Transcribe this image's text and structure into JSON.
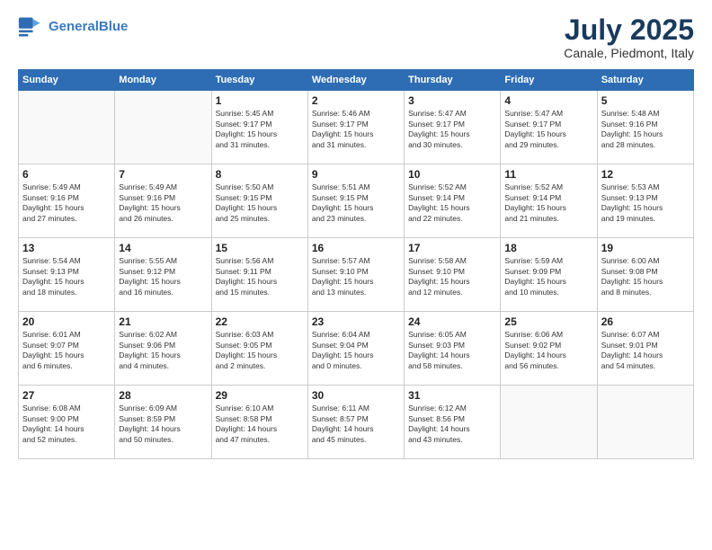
{
  "header": {
    "logo_line1": "General",
    "logo_line2": "Blue",
    "title": "July 2025",
    "subtitle": "Canale, Piedmont, Italy"
  },
  "weekdays": [
    "Sunday",
    "Monday",
    "Tuesday",
    "Wednesday",
    "Thursday",
    "Friday",
    "Saturday"
  ],
  "weeks": [
    [
      {
        "day": "",
        "info": ""
      },
      {
        "day": "",
        "info": ""
      },
      {
        "day": "1",
        "info": "Sunrise: 5:45 AM\nSunset: 9:17 PM\nDaylight: 15 hours\nand 31 minutes."
      },
      {
        "day": "2",
        "info": "Sunrise: 5:46 AM\nSunset: 9:17 PM\nDaylight: 15 hours\nand 31 minutes."
      },
      {
        "day": "3",
        "info": "Sunrise: 5:47 AM\nSunset: 9:17 PM\nDaylight: 15 hours\nand 30 minutes."
      },
      {
        "day": "4",
        "info": "Sunrise: 5:47 AM\nSunset: 9:17 PM\nDaylight: 15 hours\nand 29 minutes."
      },
      {
        "day": "5",
        "info": "Sunrise: 5:48 AM\nSunset: 9:16 PM\nDaylight: 15 hours\nand 28 minutes."
      }
    ],
    [
      {
        "day": "6",
        "info": "Sunrise: 5:49 AM\nSunset: 9:16 PM\nDaylight: 15 hours\nand 27 minutes."
      },
      {
        "day": "7",
        "info": "Sunrise: 5:49 AM\nSunset: 9:16 PM\nDaylight: 15 hours\nand 26 minutes."
      },
      {
        "day": "8",
        "info": "Sunrise: 5:50 AM\nSunset: 9:15 PM\nDaylight: 15 hours\nand 25 minutes."
      },
      {
        "day": "9",
        "info": "Sunrise: 5:51 AM\nSunset: 9:15 PM\nDaylight: 15 hours\nand 23 minutes."
      },
      {
        "day": "10",
        "info": "Sunrise: 5:52 AM\nSunset: 9:14 PM\nDaylight: 15 hours\nand 22 minutes."
      },
      {
        "day": "11",
        "info": "Sunrise: 5:52 AM\nSunset: 9:14 PM\nDaylight: 15 hours\nand 21 minutes."
      },
      {
        "day": "12",
        "info": "Sunrise: 5:53 AM\nSunset: 9:13 PM\nDaylight: 15 hours\nand 19 minutes."
      }
    ],
    [
      {
        "day": "13",
        "info": "Sunrise: 5:54 AM\nSunset: 9:13 PM\nDaylight: 15 hours\nand 18 minutes."
      },
      {
        "day": "14",
        "info": "Sunrise: 5:55 AM\nSunset: 9:12 PM\nDaylight: 15 hours\nand 16 minutes."
      },
      {
        "day": "15",
        "info": "Sunrise: 5:56 AM\nSunset: 9:11 PM\nDaylight: 15 hours\nand 15 minutes."
      },
      {
        "day": "16",
        "info": "Sunrise: 5:57 AM\nSunset: 9:10 PM\nDaylight: 15 hours\nand 13 minutes."
      },
      {
        "day": "17",
        "info": "Sunrise: 5:58 AM\nSunset: 9:10 PM\nDaylight: 15 hours\nand 12 minutes."
      },
      {
        "day": "18",
        "info": "Sunrise: 5:59 AM\nSunset: 9:09 PM\nDaylight: 15 hours\nand 10 minutes."
      },
      {
        "day": "19",
        "info": "Sunrise: 6:00 AM\nSunset: 9:08 PM\nDaylight: 15 hours\nand 8 minutes."
      }
    ],
    [
      {
        "day": "20",
        "info": "Sunrise: 6:01 AM\nSunset: 9:07 PM\nDaylight: 15 hours\nand 6 minutes."
      },
      {
        "day": "21",
        "info": "Sunrise: 6:02 AM\nSunset: 9:06 PM\nDaylight: 15 hours\nand 4 minutes."
      },
      {
        "day": "22",
        "info": "Sunrise: 6:03 AM\nSunset: 9:05 PM\nDaylight: 15 hours\nand 2 minutes."
      },
      {
        "day": "23",
        "info": "Sunrise: 6:04 AM\nSunset: 9:04 PM\nDaylight: 15 hours\nand 0 minutes."
      },
      {
        "day": "24",
        "info": "Sunrise: 6:05 AM\nSunset: 9:03 PM\nDaylight: 14 hours\nand 58 minutes."
      },
      {
        "day": "25",
        "info": "Sunrise: 6:06 AM\nSunset: 9:02 PM\nDaylight: 14 hours\nand 56 minutes."
      },
      {
        "day": "26",
        "info": "Sunrise: 6:07 AM\nSunset: 9:01 PM\nDaylight: 14 hours\nand 54 minutes."
      }
    ],
    [
      {
        "day": "27",
        "info": "Sunrise: 6:08 AM\nSunset: 9:00 PM\nDaylight: 14 hours\nand 52 minutes."
      },
      {
        "day": "28",
        "info": "Sunrise: 6:09 AM\nSunset: 8:59 PM\nDaylight: 14 hours\nand 50 minutes."
      },
      {
        "day": "29",
        "info": "Sunrise: 6:10 AM\nSunset: 8:58 PM\nDaylight: 14 hours\nand 47 minutes."
      },
      {
        "day": "30",
        "info": "Sunrise: 6:11 AM\nSunset: 8:57 PM\nDaylight: 14 hours\nand 45 minutes."
      },
      {
        "day": "31",
        "info": "Sunrise: 6:12 AM\nSunset: 8:56 PM\nDaylight: 14 hours\nand 43 minutes."
      },
      {
        "day": "",
        "info": ""
      },
      {
        "day": "",
        "info": ""
      }
    ]
  ]
}
